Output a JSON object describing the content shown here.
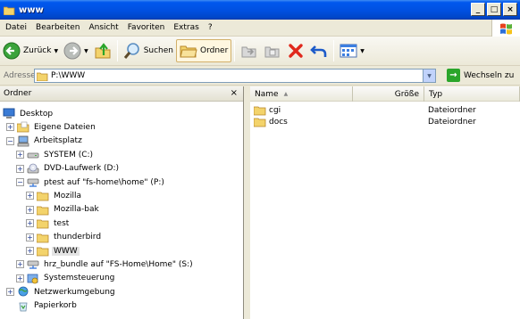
{
  "window": {
    "title": "www"
  },
  "menu": [
    "Datei",
    "Bearbeiten",
    "Ansicht",
    "Favoriten",
    "Extras",
    "?"
  ],
  "toolbar": {
    "back_label": "Zurück",
    "search_label": "Suchen",
    "folders_label": "Ordner"
  },
  "address": {
    "label": "Adresse",
    "value": "P:\\WWW",
    "go_label": "Wechseln zu"
  },
  "leftpane": {
    "header": "Ordner",
    "close": "×",
    "tree": [
      {
        "label": "Desktop",
        "indent": 0,
        "icon": "desktop-icon",
        "expander": ""
      },
      {
        "label": "Eigene Dateien",
        "indent": 1,
        "icon": "my-documents-icon",
        "expander": "+"
      },
      {
        "label": "Arbeitsplatz",
        "indent": 1,
        "icon": "my-computer-icon",
        "expander": "−"
      },
      {
        "label": "SYSTEM (C:)",
        "indent": 2,
        "icon": "drive-icon",
        "expander": "+"
      },
      {
        "label": "DVD-Laufwerk (D:)",
        "indent": 2,
        "icon": "dvd-drive-icon",
        "expander": "+"
      },
      {
        "label": "ptest auf \"fs-home\\home\" (P:)",
        "indent": 2,
        "icon": "network-drive-icon",
        "expander": "−"
      },
      {
        "label": "Mozilla",
        "indent": 3,
        "icon": "folder-icon",
        "expander": "+"
      },
      {
        "label": "Mozilla-bak",
        "indent": 3,
        "icon": "folder-icon",
        "expander": "+"
      },
      {
        "label": "test",
        "indent": 3,
        "icon": "folder-icon",
        "expander": "+"
      },
      {
        "label": "thunderbird",
        "indent": 3,
        "icon": "folder-icon",
        "expander": "+"
      },
      {
        "label": "WWW",
        "indent": 3,
        "icon": "folder-icon",
        "expander": "+",
        "selected": true
      },
      {
        "label": "hrz_bundle auf \"FS-Home\\Home\" (S:)",
        "indent": 2,
        "icon": "network-drive-icon",
        "expander": "+"
      },
      {
        "label": "Systemsteuerung",
        "indent": 2,
        "icon": "control-panel-icon",
        "expander": "+"
      },
      {
        "label": "Netzwerkumgebung",
        "indent": 1,
        "icon": "network-places-icon",
        "expander": "+"
      },
      {
        "label": "Papierkorb",
        "indent": 1,
        "icon": "recycle-bin-icon",
        "expander": ""
      }
    ]
  },
  "rightpane": {
    "columns": {
      "name": "Name",
      "size": "Größe",
      "type": "Typ"
    },
    "files": [
      {
        "name": "cgi",
        "type": "Dateiordner"
      },
      {
        "name": "docs",
        "type": "Dateiordner"
      }
    ]
  },
  "colors": {
    "titlebar": "#0058ee",
    "chrome": "#ece9d8",
    "folder": "#f3d36b",
    "delete": "#e0281c"
  }
}
